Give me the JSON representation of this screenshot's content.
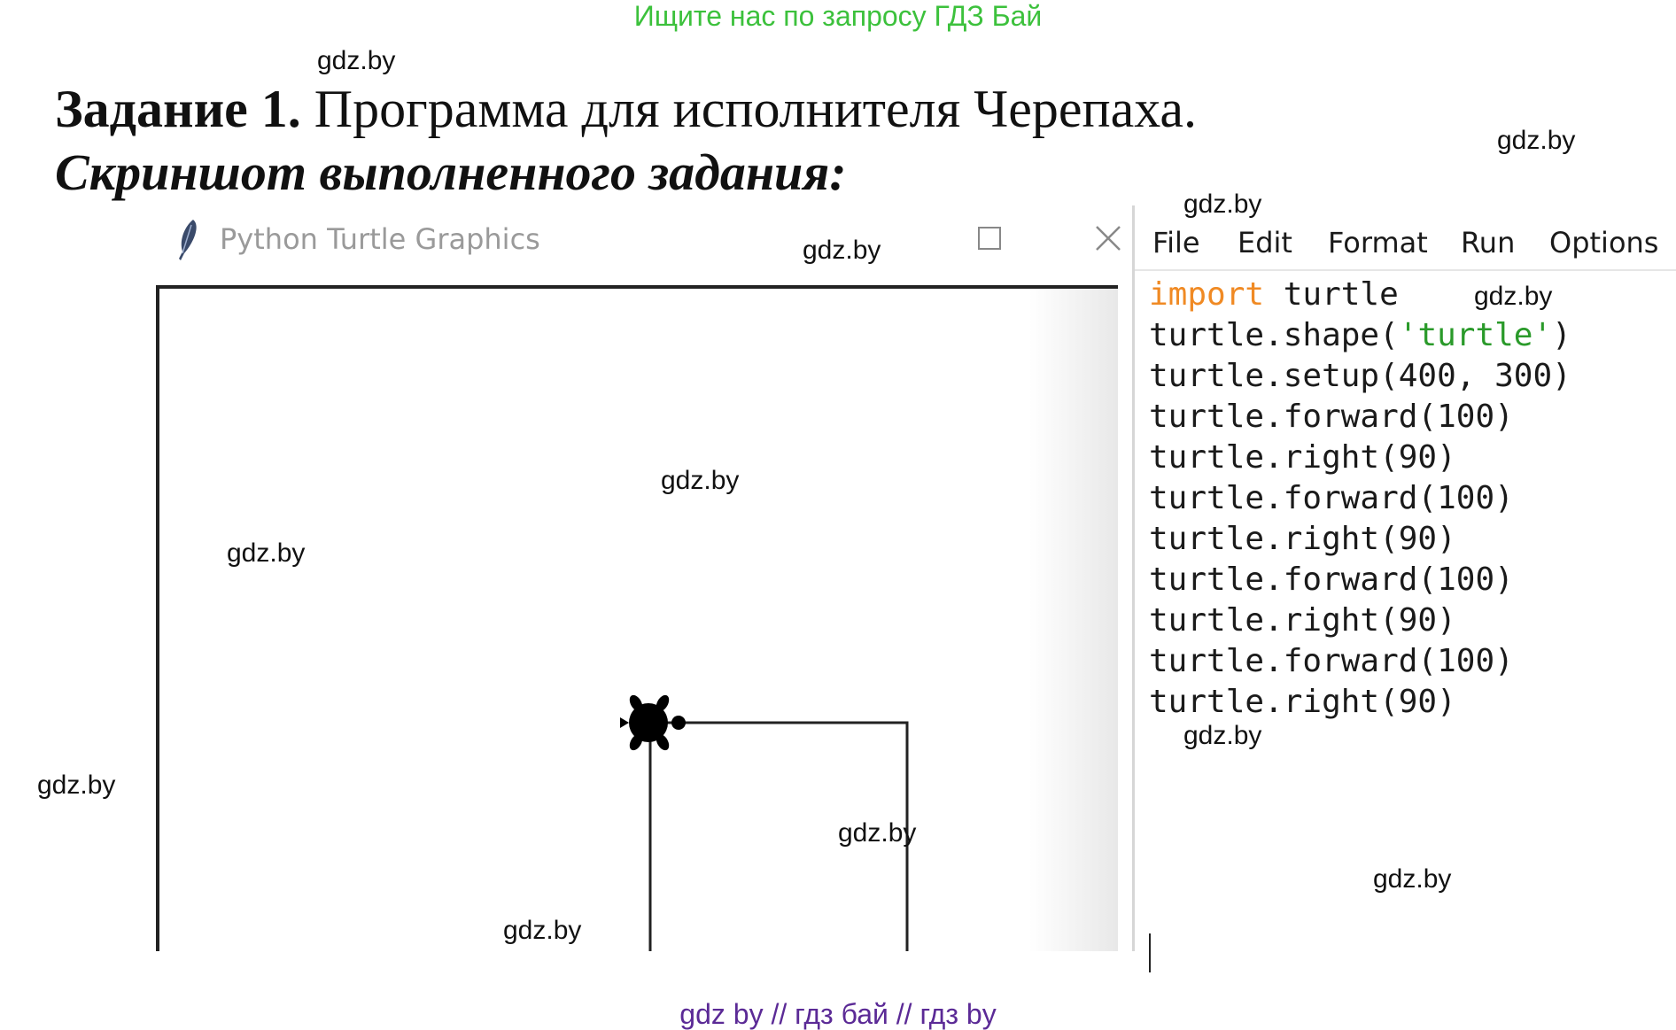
{
  "banner": "Ищите нас по запросу ГДЗ Бай",
  "watermark": "gdz.by",
  "task": {
    "label": "Задание 1.",
    "text": "Программа для исполнителя Черепаха.",
    "subtitle": "Скриншот выполненного задания:"
  },
  "turtle_window": {
    "title": "Python Turtle Graphics",
    "icons": [
      "feather-icon",
      "maximize-icon",
      "close-icon"
    ]
  },
  "editor": {
    "menu": [
      "File",
      "Edit",
      "Format",
      "Run",
      "Options"
    ],
    "code_lines": [
      [
        {
          "t": "import",
          "c": "kw"
        },
        {
          "t": " turtle",
          "c": ""
        }
      ],
      [
        {
          "t": "turtle.shape(",
          "c": ""
        },
        {
          "t": "'turtle'",
          "c": "str"
        },
        {
          "t": ")",
          "c": ""
        }
      ],
      [
        {
          "t": "turtle.setup(400, 300)",
          "c": ""
        }
      ],
      [
        {
          "t": "turtle.forward(100)",
          "c": ""
        }
      ],
      [
        {
          "t": "turtle.right(90)",
          "c": ""
        }
      ],
      [
        {
          "t": "turtle.forward(100)",
          "c": ""
        }
      ],
      [
        {
          "t": "turtle.right(90)",
          "c": ""
        }
      ],
      [
        {
          "t": "turtle.forward(100)",
          "c": ""
        }
      ],
      [
        {
          "t": "turtle.right(90)",
          "c": ""
        }
      ],
      [
        {
          "t": "turtle.forward(100)",
          "c": ""
        }
      ],
      [
        {
          "t": "turtle.right(90)",
          "c": ""
        }
      ]
    ],
    "colors": {
      "keyword": "#f08a24",
      "string": "#2a9a2a"
    }
  },
  "footer": "gdz by  //  гдз бай  //  гдз by",
  "colors": {
    "banner": "#3cc13c",
    "footer": "#5b2a96"
  }
}
